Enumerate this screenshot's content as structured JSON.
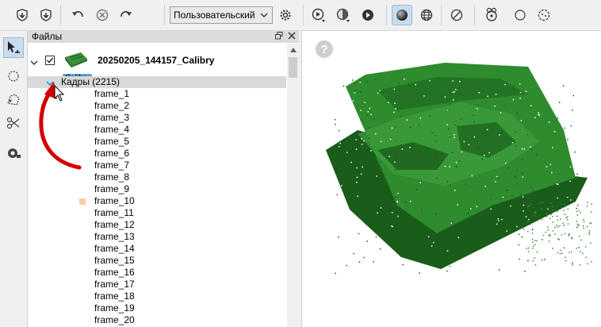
{
  "toolbar": {
    "icons": [
      "import-icon",
      "export-icon",
      "undo-icon",
      "cancel-icon",
      "redo-icon",
      "settings-gear-icon",
      "play-icon",
      "texture-sphere-icon",
      "record-icon",
      "sphere-render-icon",
      "globe-icon",
      "no-texture-icon",
      "paint-icon",
      "circle-icon",
      "dots-icon"
    ],
    "preset_select": {
      "value": "Пользовательский"
    }
  },
  "left_tools": {
    "icons": [
      "select-tool-icon",
      "lasso-circle-icon",
      "polygon-select-icon",
      "cut-icon",
      "measure-icon"
    ]
  },
  "files_panel": {
    "title": "Файлы",
    "root": {
      "name": "20250205_144157_Calibry",
      "badge": "Calibry",
      "checked": true
    },
    "folder": {
      "label": "Кадры (2215)"
    },
    "frames": [
      "frame_1",
      "frame_2",
      "frame_3",
      "frame_4",
      "frame_5",
      "frame_6",
      "frame_7",
      "frame_8",
      "frame_9",
      "frame_10",
      "frame_11",
      "frame_12",
      "frame_13",
      "frame_14",
      "frame_15",
      "frame_16",
      "frame_17",
      "frame_18",
      "frame_19",
      "frame_20"
    ],
    "marked_frame_index": 9
  },
  "viewport": {
    "help_icon": "?",
    "colors": {
      "mesh": "#2e8b2e",
      "mesh_dark": "#1a5c1a",
      "annotation_arrow": "#d40000"
    }
  }
}
